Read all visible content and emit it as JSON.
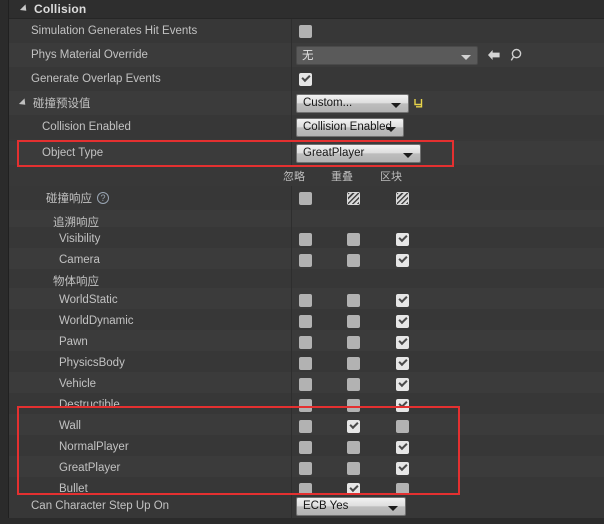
{
  "category": {
    "title": "Collision",
    "arrow_icon": "triangle-down-icon"
  },
  "columns": {
    "ignore": "忽略",
    "overlap": "重叠",
    "block": "区块"
  },
  "simple_rows": [
    {
      "label": "Simulation Generates Hit Events",
      "checkbox": "off"
    },
    {
      "label": "Generate Overlap Events",
      "checkbox": "on"
    }
  ],
  "phys_material": {
    "label": "Phys Material Override",
    "value": "无",
    "back_icon": "arrow-left-icon",
    "browse_icon": "magnifier-icon",
    "caret_icon": "chevron-down-icon"
  },
  "preset": {
    "label": "碰撞预设值",
    "value": "Custom...",
    "reset_icon": "reset-arrow-icon",
    "arrow_icon": "triangle-down-icon"
  },
  "collision_enabled": {
    "label": "Collision Enabled",
    "value": "Collision Enabled"
  },
  "object_type": {
    "label": "Object Type",
    "value": "GreatPlayer"
  },
  "collision_response": {
    "label": "碰撞响应",
    "help_icon": "question-mark-icon",
    "help_glyph": "?",
    "master": {
      "ignore": "off",
      "overlap": "hatch",
      "block": "hatch"
    }
  },
  "trace_group": {
    "label": "追溯响应"
  },
  "object_group": {
    "label": "物体响应"
  },
  "trace_rows": [
    {
      "label": "Visibility",
      "ignore": "off",
      "overlap": "off",
      "block": "on"
    },
    {
      "label": "Camera",
      "ignore": "off",
      "overlap": "off",
      "block": "on"
    }
  ],
  "object_rows": [
    {
      "label": "WorldStatic",
      "ignore": "off",
      "overlap": "off",
      "block": "on"
    },
    {
      "label": "WorldDynamic",
      "ignore": "off",
      "overlap": "off",
      "block": "on"
    },
    {
      "label": "Pawn",
      "ignore": "off",
      "overlap": "off",
      "block": "on"
    },
    {
      "label": "PhysicsBody",
      "ignore": "off",
      "overlap": "off",
      "block": "on"
    },
    {
      "label": "Vehicle",
      "ignore": "off",
      "overlap": "off",
      "block": "on"
    },
    {
      "label": "Destructible",
      "ignore": "off",
      "overlap": "off",
      "block": "on"
    },
    {
      "label": "Wall",
      "ignore": "off",
      "overlap": "on",
      "block": "off"
    },
    {
      "label": "NormalPlayer",
      "ignore": "off",
      "overlap": "off",
      "block": "on"
    },
    {
      "label": "GreatPlayer",
      "ignore": "off",
      "overlap": "off",
      "block": "on"
    },
    {
      "label": "Bullet",
      "ignore": "off",
      "overlap": "on",
      "block": "off"
    }
  ],
  "step_up": {
    "label": "Can Character Step Up On",
    "value": "ECB Yes"
  },
  "colors": {
    "highlight": "#e43030",
    "panel_bg": "#383838",
    "reset_icon": "#e8d44a"
  }
}
